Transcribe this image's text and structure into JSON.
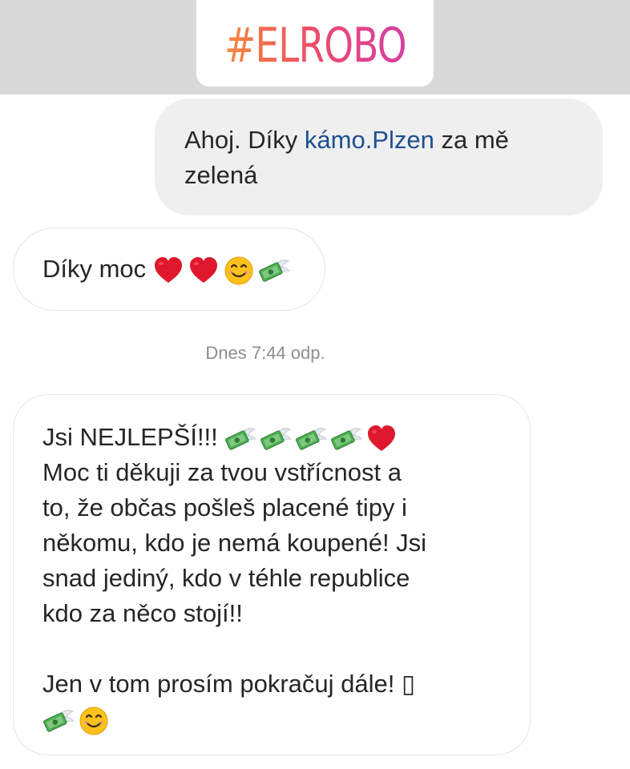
{
  "header": {
    "hashtag": "#ELROBO"
  },
  "messages": {
    "sent": {
      "line1_prefix": "Ahoj. Díky ",
      "mention": "kámo.Plzen",
      "line1_suffix": " za mě",
      "line2": "zelená"
    },
    "received_1": {
      "text": "Díky moc",
      "emojis": [
        "heart-icon",
        "heart-icon",
        "smiling-face-icon",
        "money-with-wings-icon"
      ]
    },
    "timestamp": "Dnes 7:44 odp.",
    "received_2": {
      "line1": "Jsi NEJLEPŠÍ!!!",
      "line1_emojis": [
        "money-with-wings-icon",
        "money-with-wings-icon",
        "money-with-wings-icon",
        "money-with-wings-icon",
        "heart-icon"
      ],
      "line2": "Moc ti děkuji za tvou vstřícnost a",
      "line3": "to, že občas pošleš placené tipy i",
      "line4": "někomu, kdo je nemá koupené! Jsi",
      "line5": "snad jediný, kdo v téhle republice",
      "line6": "kdo za něco stojí!!",
      "line8": "Jen v tom prosím pokračuj dále! ▯",
      "last_emojis": [
        "money-with-wings-icon",
        "smiling-face-icon"
      ]
    }
  },
  "colors": {
    "header_band": "#d9d9d9",
    "sent_bubble": "#efefef",
    "mention": "#1d4f91",
    "timestamp": "#8e8e8e",
    "heart": "#e0182d"
  }
}
